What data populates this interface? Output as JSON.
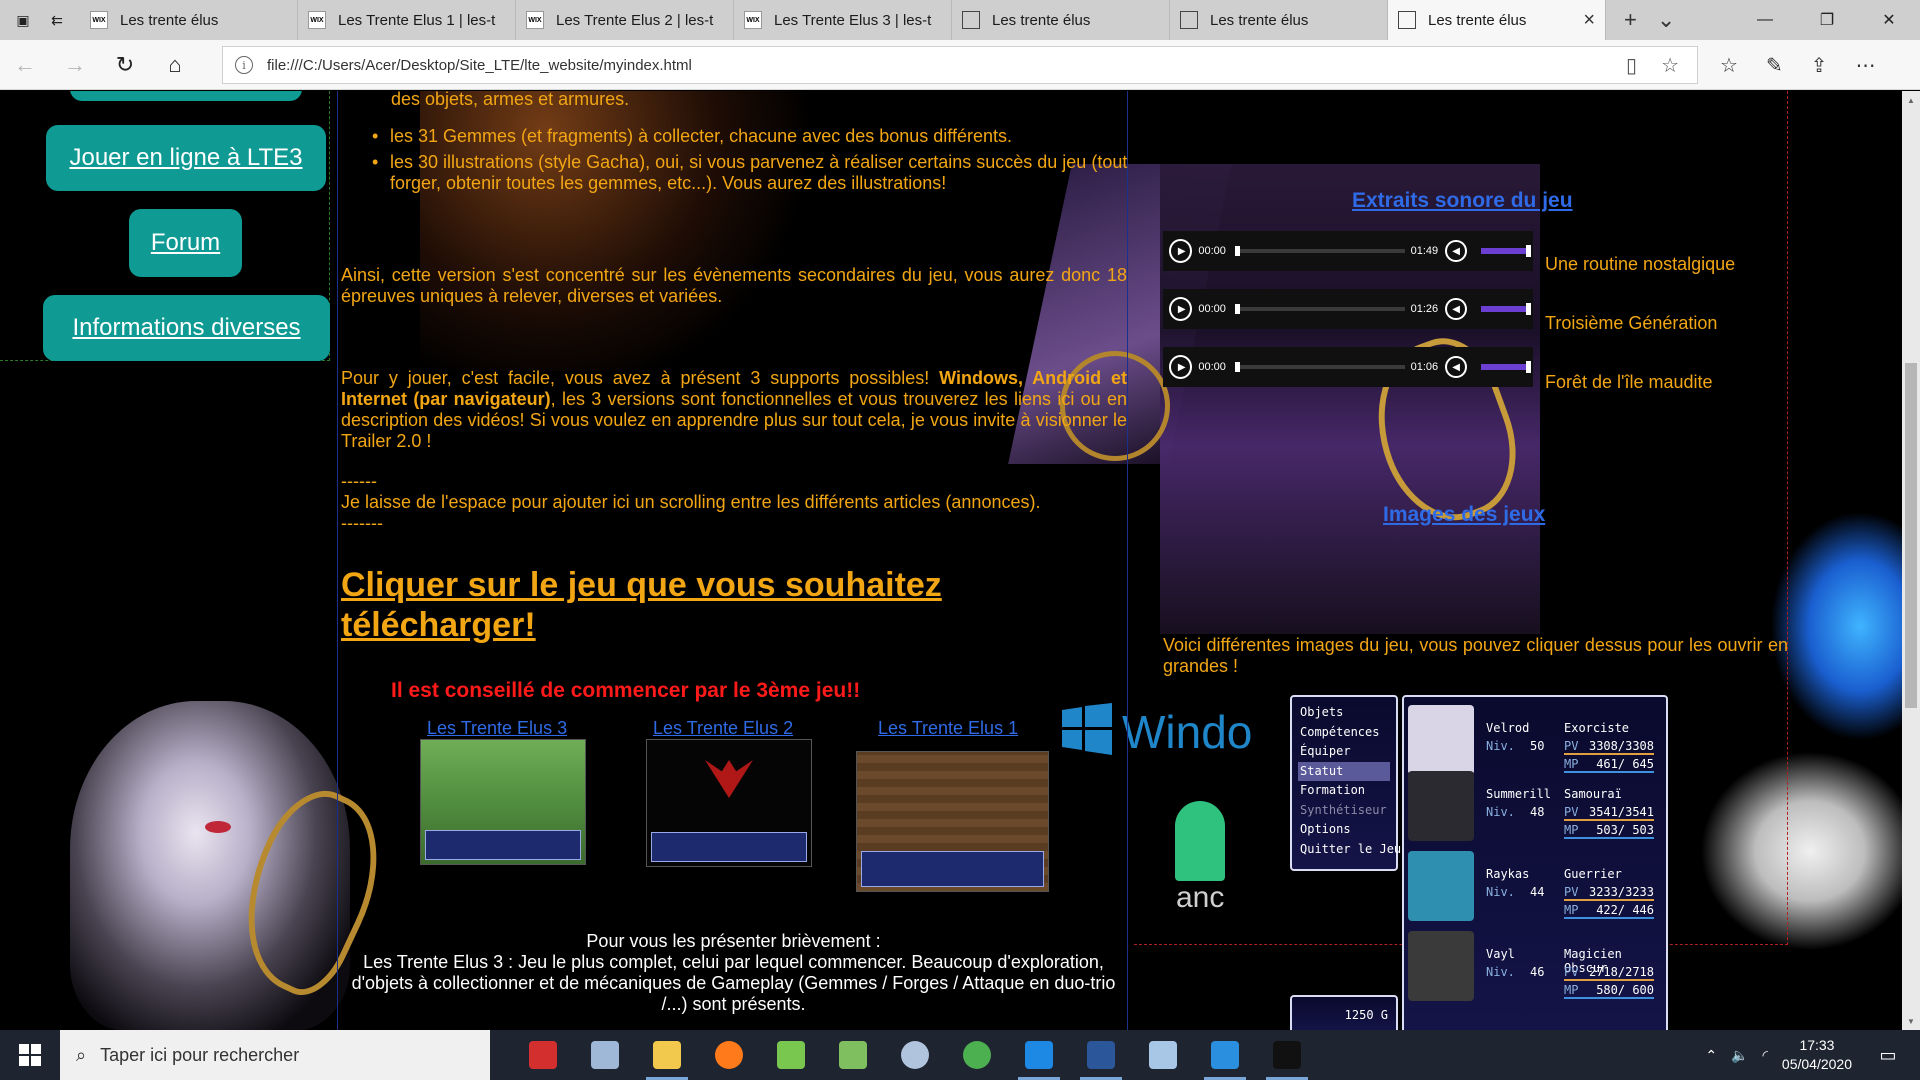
{
  "browser": {
    "tabs": [
      {
        "title": "Les trente élus",
        "favicon": "wix-icon"
      },
      {
        "title": "Les Trente Elus 1 | les-t",
        "favicon": "wix-icon"
      },
      {
        "title": "Les Trente Elus 2 | les-t",
        "favicon": "wix-icon"
      },
      {
        "title": "Les Trente Elus 3 | les-t",
        "favicon": "wix-icon"
      },
      {
        "title": "Les trente élus",
        "favicon": "page-icon"
      },
      {
        "title": "Les trente élus",
        "favicon": "page-icon"
      },
      {
        "title": "Les trente élus",
        "favicon": "page-icon",
        "active": true
      }
    ],
    "url": "file:///C:/Users/Acer/Desktop/Site_LTE/lte_website/myindex.html"
  },
  "menu": {
    "buttons": [
      "Jouer en ligne à LTE3",
      "Forum",
      "Informations diverses"
    ]
  },
  "main": {
    "bullet_cutoff": "des objets, armes et armures.",
    "bullets": [
      "les 31 Gemmes (et fragments) à collecter, chacune avec des bonus différents.",
      "les 30 illustrations (style Gacha), oui, si vous parvenez à réaliser certains succès du jeu (tout forger, obtenir toutes les gemmes, etc...). Vous aurez des illustrations!"
    ],
    "para1": "Ainsi, cette version s'est concentré sur les évènements secondaires du jeu, vous aurez donc 18 épreuves uniques à relever, diverses et variées.",
    "para2_start": "Pour y jouer, c'est facile, vous avez à présent 3 supports possibles! ",
    "para2_bold": "Windows, Android et Internet (par navigateur)",
    "para2_end": ", les 3 versions sont fonctionnelles et vous trouverez les liens ici ou en description des vidéos! Si vous voulez en apprendre plus sur tout cela, je vous invite à visionner le Trailer 2.0 !",
    "dashes1": "------",
    "note": "Je laisse de l'espace pour ajouter ici un scrolling entre les différents articles (annonces).",
    "dashes2": "-------",
    "download_title": "Cliquer sur le jeu que vous souhaitez télécharger!",
    "advice": "Il est conseillé de commencer par le 3ème jeu!!",
    "games": [
      "Les Trente Elus 3",
      "Les Trente Elus 2",
      "Les Trente Elus 1"
    ],
    "intro_title": "Pour vous les présenter brièvement :",
    "intro_text": "Les Trente Elus 3 : Jeu le plus complet, celui par lequel commencer. Beaucoup d'exploration, d'objets à collectionner et de mécaniques de Gameplay (Gemmes / Forges / Attaque en duo-trio /...) sont présents."
  },
  "side": {
    "audio_title": "Extraits sonore du jeu",
    "tracks": [
      {
        "time": "00:00",
        "duration": "01:49",
        "label": "Une routine nostalgique"
      },
      {
        "time": "00:00",
        "duration": "01:26",
        "label": "Troisième Génération"
      },
      {
        "time": "00:00",
        "duration": "01:06",
        "label": "Forêt de l'île maudite"
      }
    ],
    "images_title": "Images des jeux",
    "images_desc": "Voici différentes images du jeu, vous pouvez cliquer dessus pour les ouvrir en grandes !",
    "windows_logo_text": "Windo",
    "android_logo_text": "anc"
  },
  "rpg": {
    "menu": [
      "Objets",
      "Compétences",
      "Équiper",
      "Statut",
      "Formation",
      "Synthétiseur",
      "Options",
      "Quitter le Jeu"
    ],
    "selected": "Statut",
    "disabled": "Synthétiseur",
    "gold": "1250 G",
    "lvl_label": "Niv.",
    "hp_label": "PV",
    "mp_label": "MP",
    "party": [
      {
        "name": "Velrod",
        "level": "50",
        "class": "Exorciste",
        "hp": "3308/3308",
        "mp": "461/ 645",
        "face": "#d9d4e6"
      },
      {
        "name": "Summerill",
        "level": "48",
        "class": "Samouraï",
        "hp": "3541/3541",
        "mp": "503/ 503",
        "face": "#2a2a30"
      },
      {
        "name": "Raykas",
        "level": "44",
        "class": "Guerrier",
        "hp": "3233/3233",
        "mp": "422/ 446",
        "face": "#2f8fb0"
      },
      {
        "name": "Vayl",
        "level": "46",
        "class": "Magicien Obscur",
        "hp": "2718/2718",
        "mp": "580/ 600",
        "face": "#3a3a3a"
      }
    ]
  },
  "taskbar": {
    "search_placeholder": "Taper ici pour rechercher",
    "time": "17:33",
    "date": "05/04/2020",
    "apps": [
      "acrobat-icon",
      "paint-icon",
      "explorer-icon",
      "firefox-icon",
      "colors-icon",
      "notepad-icon",
      "mouse-icon",
      "chrome-icon",
      "edge-icon",
      "word-icon",
      "notes-icon",
      "vscode-icon",
      "terminal-icon"
    ],
    "app_colors": [
      "#d32f2f",
      "#9fb8d8",
      "#f2c94c",
      "#ff7a1a",
      "#7ac74f",
      "#7fbf5f",
      "#b0c4de",
      "#4caf50",
      "#1e88e5",
      "#2b579a",
      "#a8c6e6",
      "#2b8fe0",
      "#111111"
    ]
  },
  "colors": {
    "orange_text": "#f2a614",
    "teal_button": "#0f9a94",
    "link_blue": "#2f6be6",
    "advice_red": "#ff1a1a"
  }
}
